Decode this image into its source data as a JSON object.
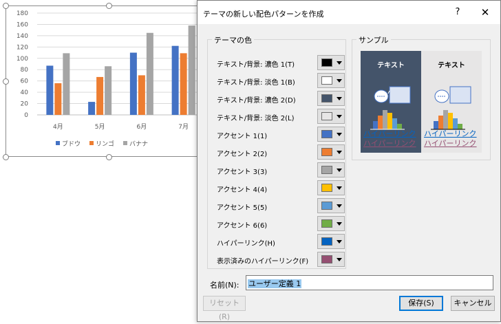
{
  "chart_data": {
    "type": "bar",
    "categories": [
      "4月",
      "5月",
      "6月",
      "7月"
    ],
    "series": [
      {
        "name": "ブドウ",
        "color": "#4472c4",
        "values": [
          87,
          23,
          110,
          122
        ]
      },
      {
        "name": "リンゴ",
        "color": "#ed7d31",
        "values": [
          56,
          67,
          70,
          109
        ]
      },
      {
        "name": "バナナ",
        "color": "#a5a5a5",
        "values": [
          109,
          86,
          145,
          158
        ]
      }
    ],
    "yticks": [
      "0",
      "20",
      "40",
      "60",
      "80",
      "100",
      "120",
      "140",
      "160",
      "180"
    ],
    "ylim": [
      0,
      180
    ],
    "grid": true,
    "legend": "bottom"
  },
  "dialog": {
    "title": "テーマの新しい配色パターンを作成",
    "help": "?",
    "close": "✕",
    "theme_group_label": "テーマの色",
    "sample_group_label": "サンプル",
    "rows": [
      {
        "label": "テキスト/背景: 濃色 1(T)",
        "color": "#000000"
      },
      {
        "label": "テキスト/背景: 淡色 1(B)",
        "color": "#ffffff"
      },
      {
        "label": "テキスト/背景: 濃色 2(D)",
        "color": "#44546a"
      },
      {
        "label": "テキスト/背景: 淡色 2(L)",
        "color": "#e7e6e6"
      },
      {
        "label": "アクセント 1(1)",
        "color": "#4472c4"
      },
      {
        "label": "アクセント 2(2)",
        "color": "#ed7d31"
      },
      {
        "label": "アクセント 3(3)",
        "color": "#a5a5a5"
      },
      {
        "label": "アクセント 4(4)",
        "color": "#ffc000"
      },
      {
        "label": "アクセント 5(5)",
        "color": "#5b9bd5"
      },
      {
        "label": "アクセント 6(6)",
        "color": "#70ad47"
      },
      {
        "label": "ハイパーリンク(H)",
        "color": "#0563c1"
      },
      {
        "label": "表示済みのハイパーリンク(F)",
        "color": "#954f72"
      }
    ],
    "sample": {
      "text": "テキスト",
      "hyperlink": "ハイパーリンク",
      "followed_hyperlink": "ハイパーリンク"
    },
    "name_label": "名前(N):",
    "name_value": "ユーザー定義 1",
    "reset_label": "リセット(R)",
    "save_label": "保存(S)",
    "cancel_label": "キャンセル"
  }
}
